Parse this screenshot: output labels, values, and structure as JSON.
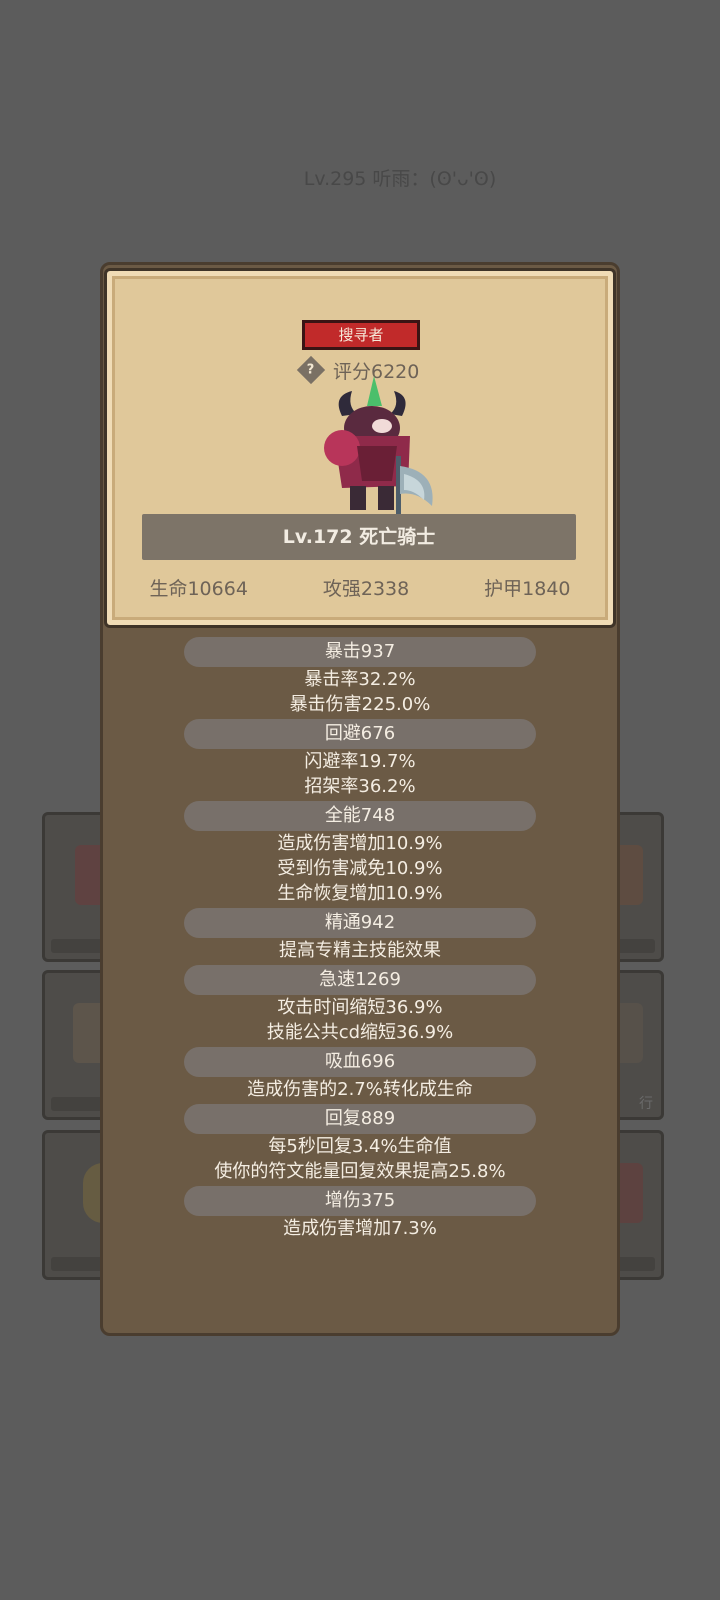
{
  "player_header": "Lv.295 听雨：(ʘ'ᴗ'ʘ)",
  "card": {
    "class_badge": "搜寻者",
    "score": "评分6220",
    "name": "Lv.172 死亡骑士",
    "hp": "生命10664",
    "attack": "攻强2338",
    "armor": "护甲1840"
  },
  "stats": [
    {
      "header": "暴击937",
      "details": [
        "暴击率32.2%",
        "暴击伤害225.0%"
      ]
    },
    {
      "header": "回避676",
      "details": [
        "闪避率19.7%",
        "招架率36.2%"
      ]
    },
    {
      "header": "全能748",
      "details": [
        "造成伤害增加10.9%",
        "受到伤害减免10.9%",
        "生命恢复增加10.9%"
      ]
    },
    {
      "header": "精通942",
      "details": [
        "提高专精主技能效果"
      ]
    },
    {
      "header": "急速1269",
      "details": [
        "攻击时间缩短36.9%",
        "技能公共cd缩短36.9%"
      ]
    },
    {
      "header": "吸血696",
      "details": [
        "造成伤害的2.7%转化成生命"
      ]
    },
    {
      "header": "回复889",
      "details": [
        "每5秒回复3.4%生命值",
        "使你的符文能量回复效果提高25.8%"
      ]
    },
    {
      "header": "增伤375",
      "details": [
        "造成伤害增加7.3%"
      ]
    }
  ],
  "background_slot_text": "行",
  "icons": {
    "help": "question-diamond-icon",
    "character": "death-knight-sprite"
  }
}
